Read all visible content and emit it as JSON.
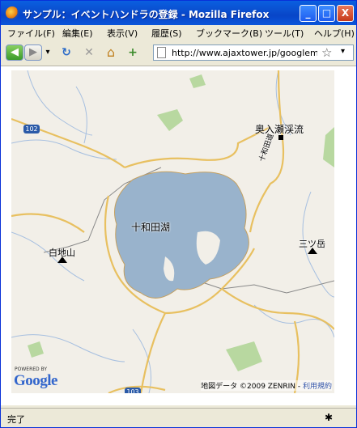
{
  "window": {
    "title": "サンプル：イベントハンドラの登録 - Mozilla Firefox"
  },
  "window_controls": {
    "minimize": "_",
    "maximize": "□",
    "close": "X"
  },
  "menubar": {
    "items": [
      "ファイル(F)",
      "編集(E)",
      "表示(V)",
      "履歴(S)",
      "ブックマーク(B)",
      "ツール(T)",
      "ヘルプ(H)"
    ]
  },
  "navbar": {
    "back": "◀",
    "forward": "▶",
    "dropdown": "▾",
    "reload": "↻",
    "stop": "✕",
    "home": "⌂",
    "addon": "+",
    "url": "http://www.ajaxtower.jp/googlemap",
    "bookmark_star": "☆",
    "url_dropdown": "▾"
  },
  "map": {
    "labels": {
      "lake": "十和田湖",
      "oirase": "奥入瀬渓流",
      "oirase_road": "十和田道",
      "shirajiyama": "白地山",
      "mitsudake": "三ツ岳",
      "route102": "102",
      "route103": "103"
    },
    "google_powered": "POWERED BY",
    "google_logo": "Google",
    "copyright": "地図データ ©2009 ZENRIN - ",
    "terms": "利用規約",
    "colors": {
      "water": "#99b3cc",
      "road": "#e8c060",
      "park": "#b8d8a0",
      "river": "#a6bfe0",
      "land": "#f2efe8"
    }
  },
  "status": {
    "text": "完了"
  }
}
